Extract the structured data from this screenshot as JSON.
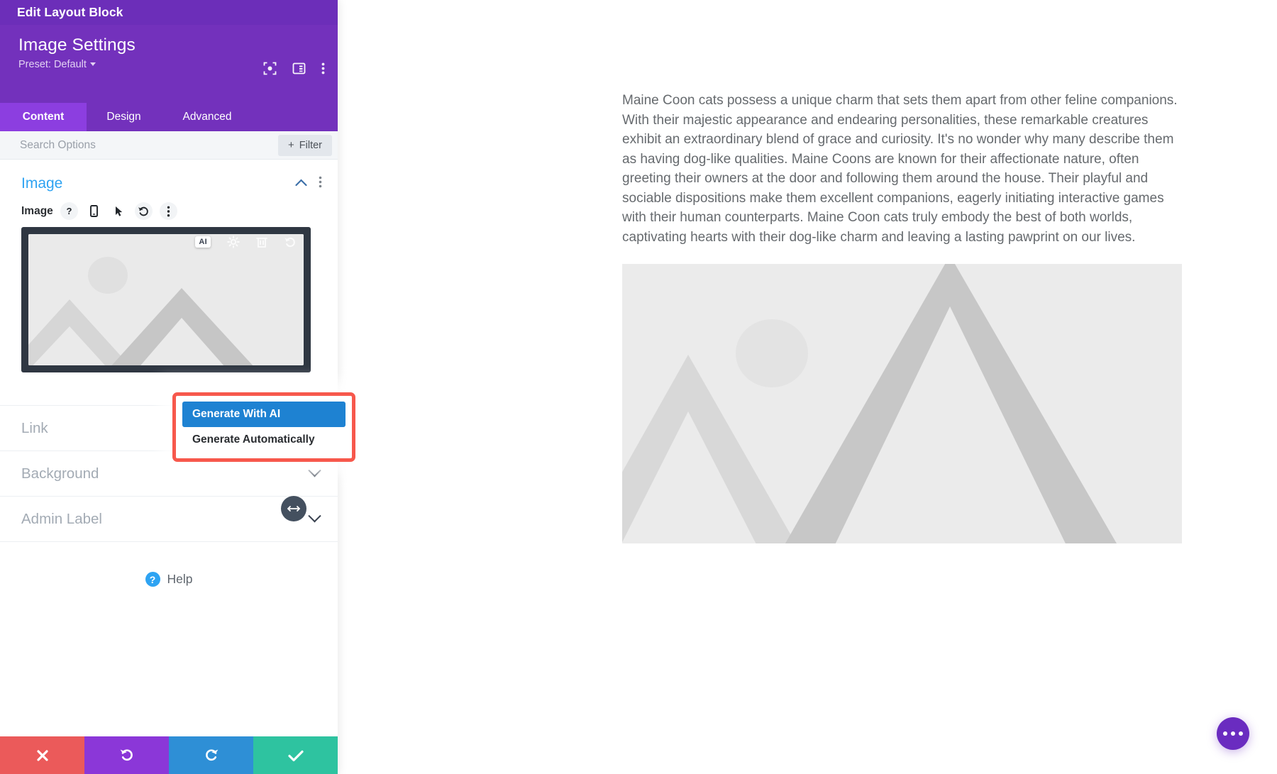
{
  "window": {
    "title": "Edit Layout Block"
  },
  "panel": {
    "heading": "Image Settings",
    "preset_label": "Preset: Default",
    "header_icons": [
      {
        "name": "focus-icon",
        "glyph": "focus"
      },
      {
        "name": "panel-layout-icon",
        "glyph": "panel"
      },
      {
        "name": "more-options-icon",
        "glyph": "kebab"
      }
    ],
    "tabs": [
      {
        "label": "Content",
        "active": true
      },
      {
        "label": "Design",
        "active": false
      },
      {
        "label": "Advanced",
        "active": false
      }
    ],
    "search": {
      "placeholder": "Search Options",
      "value": ""
    },
    "filter_button": {
      "label": "Filter",
      "plus": "+"
    },
    "open_section": {
      "title": "Image",
      "collapse_icon": "chevron-up-icon",
      "more_icon": "kebab-icon"
    },
    "image_field": {
      "label": "Image",
      "icons": [
        {
          "name": "help-icon",
          "glyph": "?"
        },
        {
          "name": "responsive-mobile-icon",
          "glyph": "phone"
        },
        {
          "name": "hover-cursor-icon",
          "glyph": "cursor"
        },
        {
          "name": "reset-icon",
          "glyph": "undo"
        },
        {
          "name": "field-options-icon",
          "glyph": "kebab"
        }
      ]
    },
    "image_toolbar": [
      {
        "name": "ai-badge",
        "label": "AI"
      },
      {
        "name": "settings-gear-icon",
        "label": "Settings"
      },
      {
        "name": "delete-trash-icon",
        "label": "Delete"
      },
      {
        "name": "undo-reset-icon",
        "label": "Reset"
      }
    ],
    "ai_dropdown": {
      "items": [
        {
          "label": "Generate With AI",
          "selected": true
        },
        {
          "label": "Generate Automatically",
          "selected": false
        }
      ],
      "highlight_color": "#f7584c",
      "selected_color": "#1e82d2"
    },
    "resize_handle": {
      "name": "panel-resize-handle"
    },
    "accordion": [
      {
        "label": "Link"
      },
      {
        "label": "Background"
      },
      {
        "label": "Admin Label"
      }
    ],
    "help": {
      "badge": "?",
      "label": "Help"
    },
    "footer_buttons": [
      {
        "name": "cancel-button",
        "glyph": "close",
        "color": "#eb5a5a"
      },
      {
        "name": "undo-button",
        "glyph": "undo",
        "color": "#8b37d8"
      },
      {
        "name": "redo-button",
        "glyph": "redo",
        "color": "#2e8fd6"
      },
      {
        "name": "save-button",
        "glyph": "check",
        "color": "#2ec3a0"
      }
    ]
  },
  "content": {
    "paragraph": "Maine Coon cats possess a unique charm that sets them apart from other feline companions. With their majestic appearance and endearing personalities, these remarkable creatures exhibit an extraordinary blend of grace and curiosity. It's no wonder why many describe them as having dog-like qualities. Maine Coons are known for their affectionate nature, often greeting their owners at the door and following them around the house. Their playful and sociable dispositions make them excellent companions, eagerly initiating interactive games with their human counterparts. Maine Coon cats truly embody the best of both worlds, captivating hearts with their dog-like charm and leaving a lasting pawprint on our lives.",
    "hero_image": {
      "name": "placeholder-image",
      "alt": "Image placeholder with mountains and sun"
    },
    "fab": {
      "name": "page-settings-fab",
      "glyph": "ellipsis"
    }
  },
  "theme": {
    "purple_dark": "#6c2eb9",
    "purple": "#7331bc",
    "purple_active": "#8c3ee0",
    "blue_link": "#2ea3f2",
    "gray_text": "#a3abb4"
  }
}
